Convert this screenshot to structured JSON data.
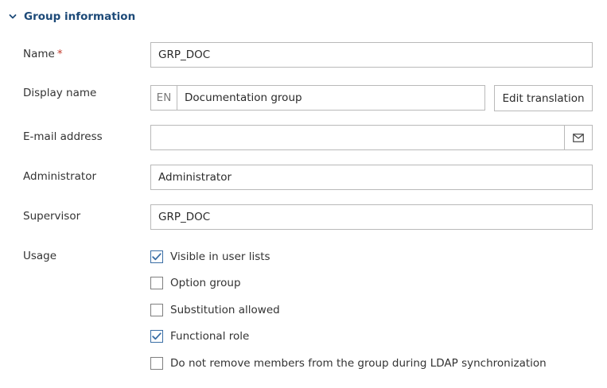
{
  "section": {
    "title": "Group information",
    "icon": "chevron-down-icon"
  },
  "form": {
    "name": {
      "label": "Name",
      "required_mark": "*",
      "value": "GRP_DOC"
    },
    "display_name": {
      "label": "Display name",
      "language": "EN",
      "value": "Documentation group",
      "edit_translation_label": "Edit translation"
    },
    "email": {
      "label": "E-mail address",
      "value": "",
      "icon": "envelope-icon"
    },
    "administrator": {
      "label": "Administrator",
      "value": "Administrator"
    },
    "supervisor": {
      "label": "Supervisor",
      "value": "GRP_DOC"
    },
    "usage": {
      "label": "Usage",
      "options": [
        {
          "label": "Visible in user lists",
          "checked": true
        },
        {
          "label": "Option group",
          "checked": false
        },
        {
          "label": "Substitution allowed",
          "checked": false
        },
        {
          "label": "Functional role",
          "checked": true
        },
        {
          "label": "Do not remove members from the group during LDAP synchronization",
          "checked": false
        }
      ]
    }
  },
  "colors": {
    "accent": "#1d4a78",
    "required": "#c0392b",
    "check": "#3a6ea5",
    "border": "#b9b9b9"
  }
}
